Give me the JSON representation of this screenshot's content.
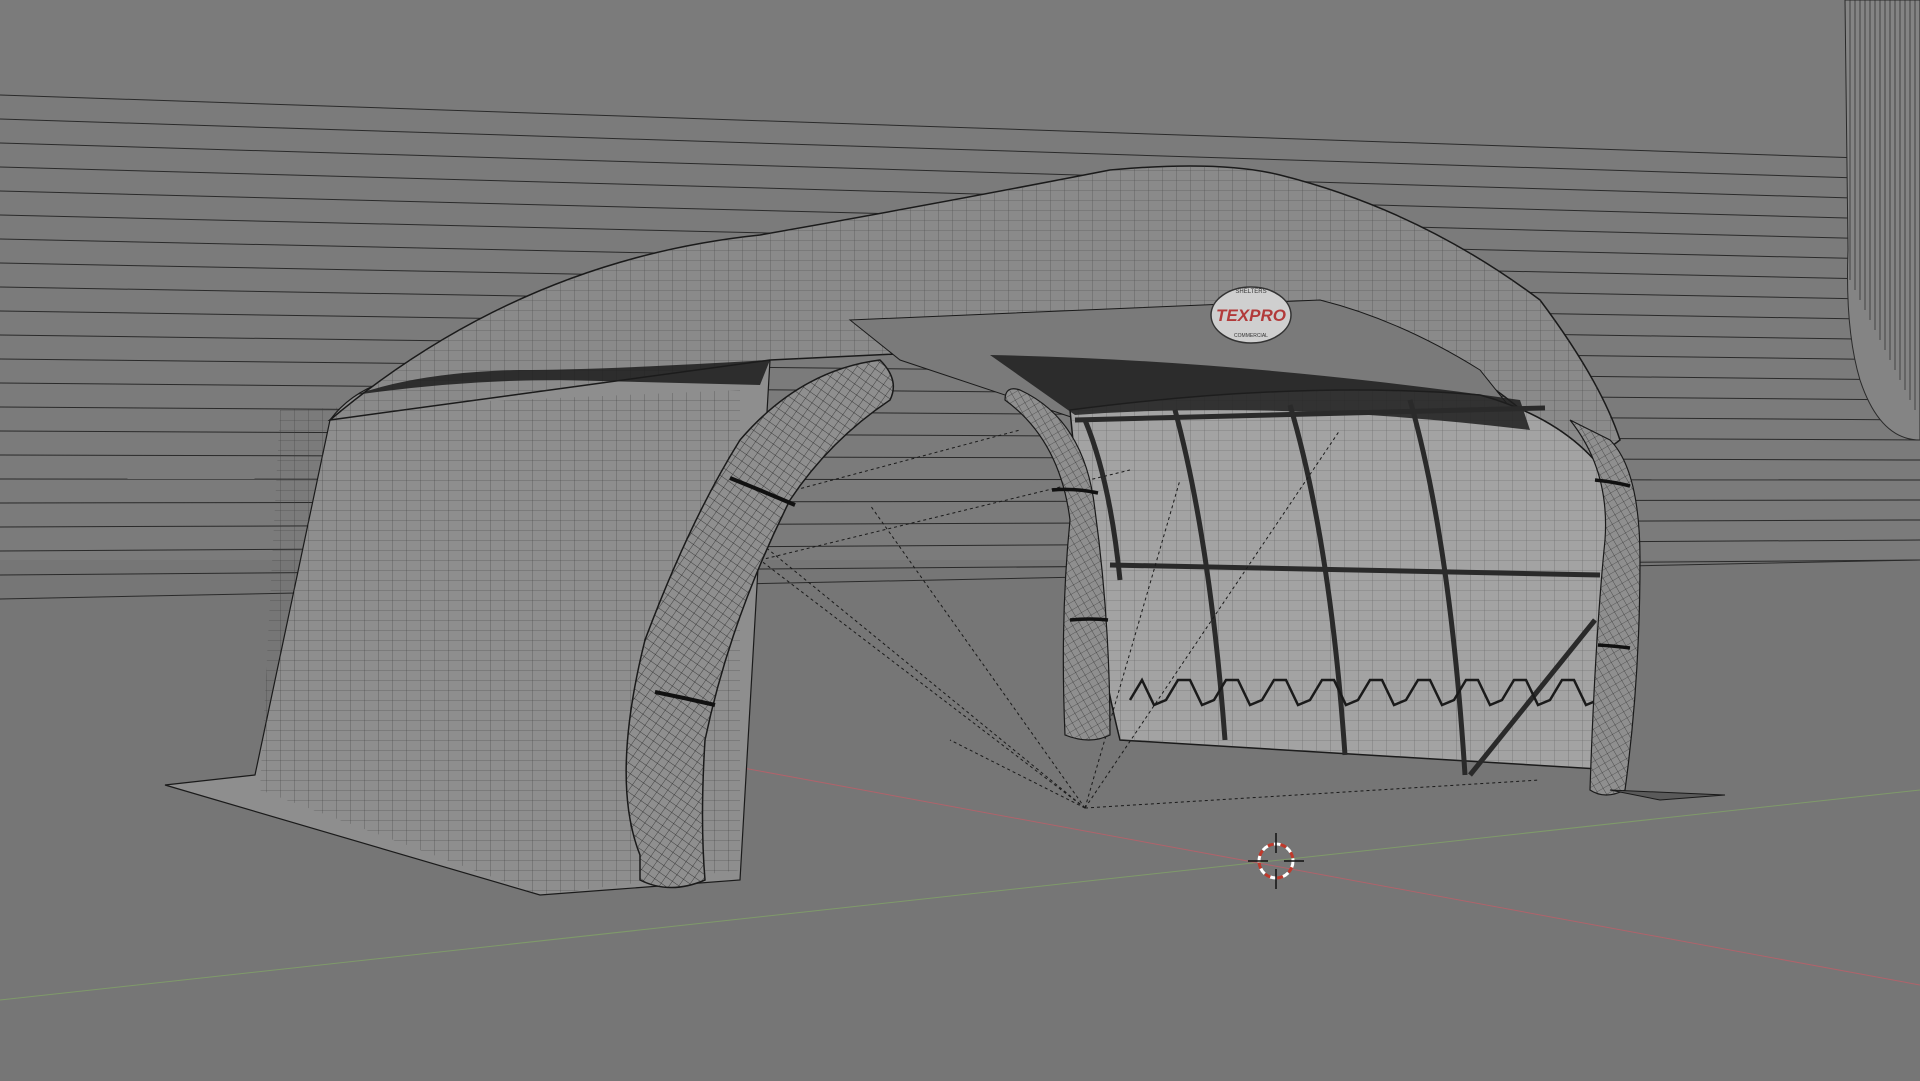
{
  "viewport": {
    "mode": "wireframe",
    "background_color": "#7b7b7b",
    "floor_color": "#757575",
    "wire_color": "#1a1a1a",
    "x_axis_color": "#b0636b",
    "y_axis_color": "#7f9a6a"
  },
  "model": {
    "logo_text": "TEXPRO",
    "logo_subtext_top": "SHELTERS",
    "logo_subtext_bottom": "COMMERCIAL",
    "logo_color": "#b23a3a"
  },
  "cursor_3d": {
    "icon": "3d-cursor-icon",
    "ring_colors": [
      "#c0392b",
      "#ffffff"
    ]
  }
}
